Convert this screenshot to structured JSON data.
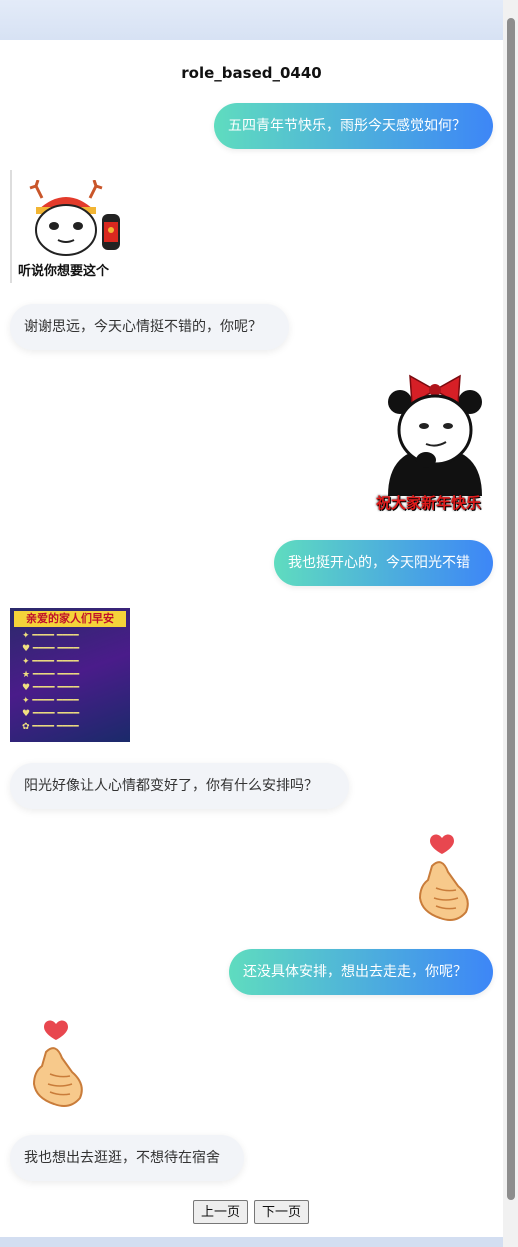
{
  "title": "role_based_0440",
  "messages": [
    {
      "text": "五四青年节快乐，雨彤今天感觉如何？"
    },
    {
      "caption": "听说你想要这个"
    },
    {
      "text": "谢谢思远，今天心情挺不错的，你呢？"
    },
    {
      "caption": "祝大家新年快乐"
    },
    {
      "text": "我也挺开心的，今天阳光不错"
    },
    {
      "poster_title": "亲爱的家人们早安"
    },
    {
      "text": "阳光好像让人心情都变好了，你有什么安排吗？"
    },
    {
      "sticker": "finger-heart-icon"
    },
    {
      "text": "还没具体安排，想出去走走，你呢？"
    },
    {
      "sticker": "finger-heart-icon"
    },
    {
      "text": "我也想出去逛逛，不想待在宿舍"
    }
  ],
  "pager": {
    "prev": "上一页",
    "next": "下一页"
  }
}
